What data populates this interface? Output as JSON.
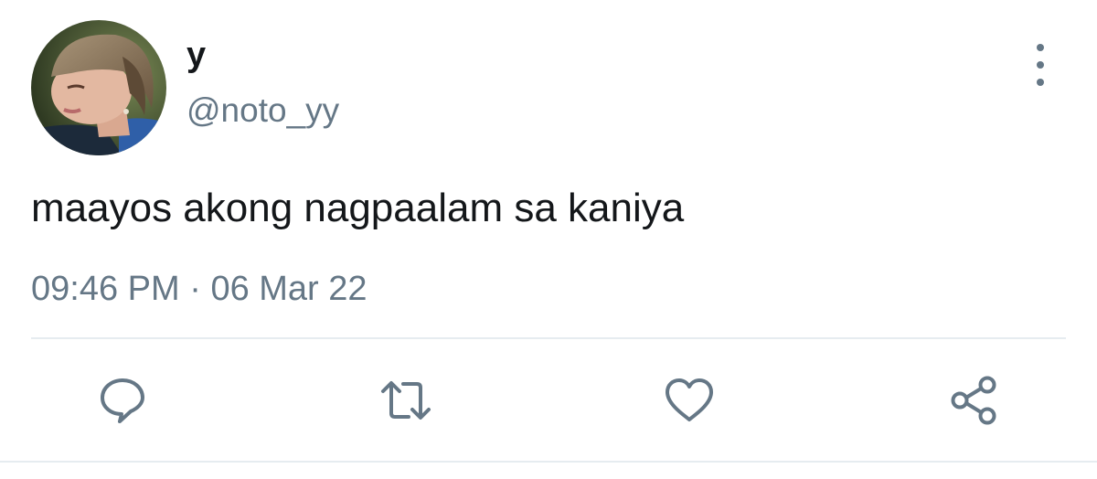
{
  "user": {
    "display_name": "y",
    "handle": "@noto_yy"
  },
  "tweet": {
    "text": "maayos akong nagpaalam sa kaniya",
    "time": "09:46 PM",
    "separator": "·",
    "date": "06 Mar 22"
  },
  "actions": [
    {
      "name": "reply",
      "icon": "comment-icon"
    },
    {
      "name": "retweet",
      "icon": "retweet-icon"
    },
    {
      "name": "like",
      "icon": "heart-icon"
    },
    {
      "name": "share",
      "icon": "share-icon"
    }
  ],
  "colors": {
    "text_primary": "#14171a",
    "text_secondary": "#657786",
    "divider": "#e6ecf0",
    "background": "#ffffff"
  }
}
